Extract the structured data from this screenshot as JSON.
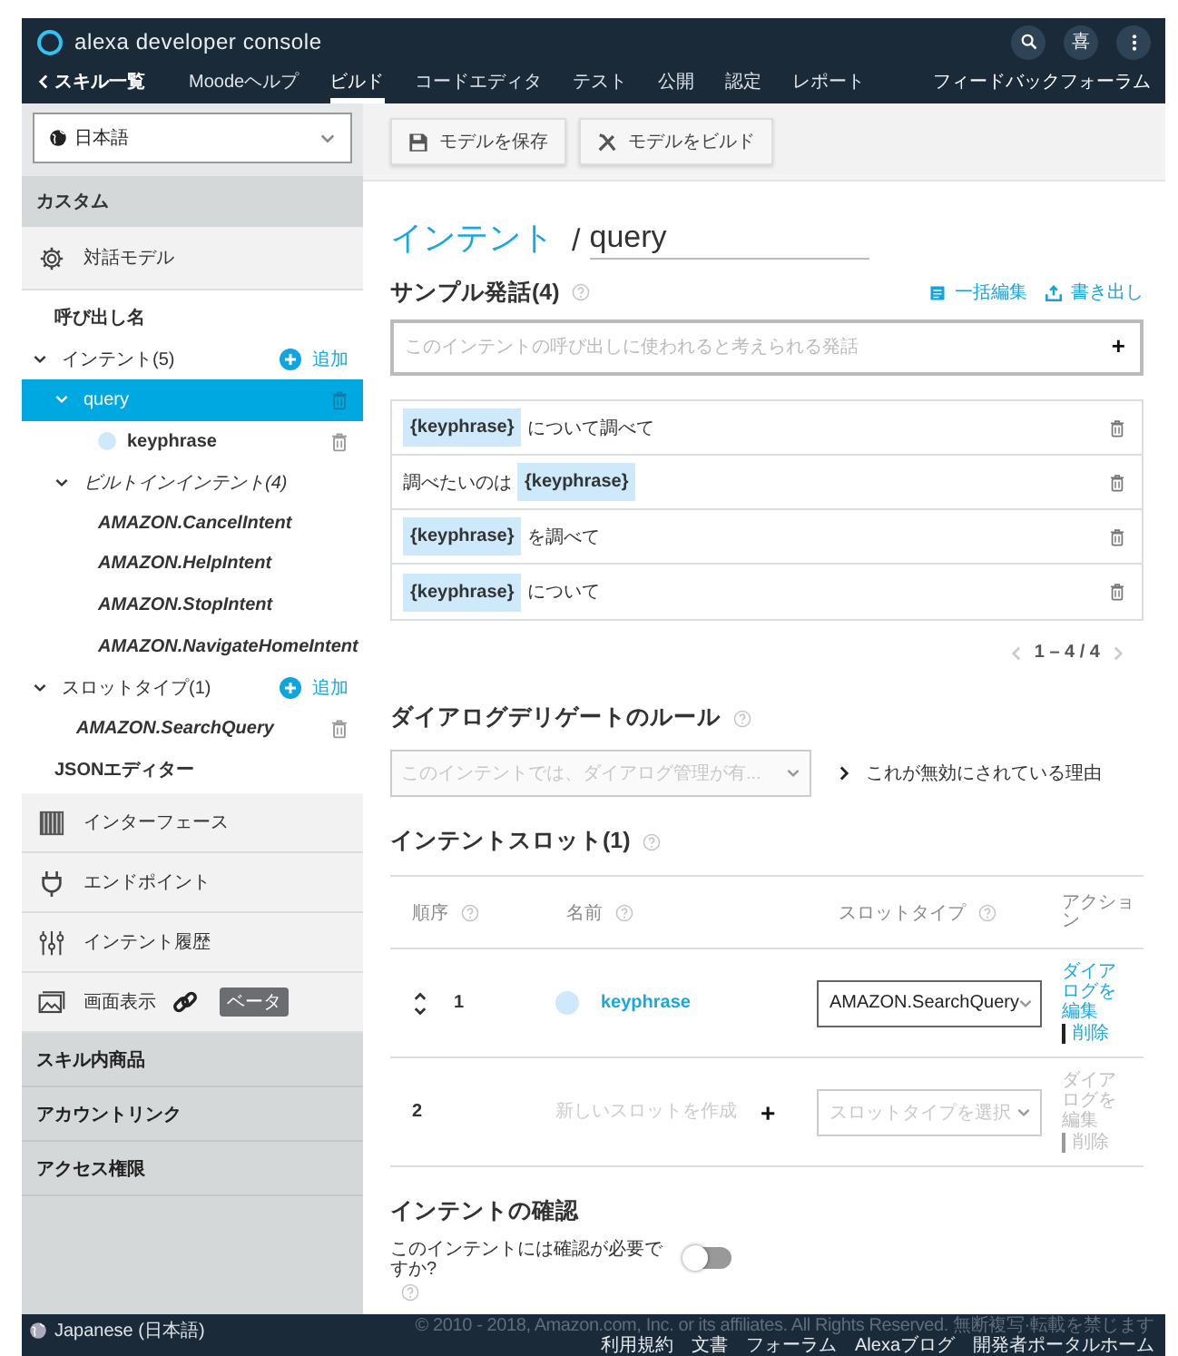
{
  "header": {
    "title": "alexa developer console",
    "avatar": "喜",
    "back": "スキル一覧",
    "nav": [
      {
        "label": "Moodeヘルプ",
        "selected": false
      },
      {
        "label": "ビルド",
        "selected": true
      },
      {
        "label": "コードエディタ",
        "selected": false
      },
      {
        "label": "テスト",
        "selected": false
      },
      {
        "label": "公開",
        "selected": false
      },
      {
        "label": "認定",
        "selected": false
      },
      {
        "label": "レポート",
        "selected": false
      }
    ],
    "feedback": "フィードバックフォーラム"
  },
  "sidebar": {
    "language": "日本語",
    "section_title": "カスタム",
    "model": "対話モデル",
    "tree": [
      {
        "kind": "link",
        "label": "呼び出し名",
        "selected": false
      },
      {
        "kind": "group",
        "label": "インテント(5)",
        "selected": false,
        "expanded": true,
        "action": "追加",
        "children": [
          {
            "kind": "item",
            "label": "query",
            "selected": true,
            "expanded": true,
            "deletable": true,
            "children": [
              {
                "kind": "slot",
                "label": "keyphrase",
                "selected": false,
                "deletable": true
              }
            ]
          },
          {
            "kind": "builtin_group",
            "label": "ビルトインインテント(4)",
            "selected": false,
            "expanded": true,
            "children": [
              {
                "kind": "builtin",
                "label": "AMAZON.CancelIntent",
                "selected": false
              },
              {
                "kind": "builtin",
                "label": "AMAZON.HelpIntent",
                "selected": false
              },
              {
                "kind": "builtin",
                "label": "AMAZON.StopIntent",
                "selected": false
              },
              {
                "kind": "builtin",
                "label": "AMAZON.NavigateHomeIntent",
                "selected": false
              }
            ]
          }
        ]
      },
      {
        "kind": "group",
        "label": "スロットタイプ(1)",
        "selected": false,
        "expanded": true,
        "action": "追加",
        "children": [
          {
            "kind": "builtin",
            "label": "AMAZON.SearchQuery",
            "selected": false,
            "deletable": true
          }
        ]
      },
      {
        "kind": "link",
        "label": "JSONエディター",
        "selected": false
      }
    ],
    "tools": [
      {
        "kind": "interface",
        "label": "インターフェース",
        "linked": false
      },
      {
        "kind": "endpoint",
        "label": "エンドポイント",
        "linked": false
      },
      {
        "kind": "history",
        "label": "インテント履歴",
        "linked": false
      },
      {
        "kind": "display",
        "label": "画面表示",
        "linked": true,
        "badge": "ベータ"
      }
    ],
    "sections": [
      "スキル内商品",
      "アカウントリンク",
      "アクセス権限"
    ]
  },
  "toolbar": [
    {
      "kind": "save",
      "label": "モデルを保存"
    },
    {
      "kind": "build",
      "label": "モデルをビルド"
    }
  ],
  "breadcrumb": {
    "link": "インテント",
    "separator": "/",
    "name": "query"
  },
  "utterances": {
    "title": "サンプル発話(4)",
    "help": true,
    "actions": [
      {
        "kind": "edit",
        "label": "一括編集"
      },
      {
        "kind": "export",
        "label": "書き出し"
      }
    ],
    "placeholder": "このインテントの呼び出しに使われると考えられる発話",
    "add": "+",
    "items": [
      {
        "parts": [
          {
            "kind": "slot",
            "text": "{keyphrase}"
          },
          {
            "kind": "text",
            "text": "について調べて"
          }
        ]
      },
      {
        "parts": [
          {
            "kind": "text",
            "text": "調べたいのは"
          },
          {
            "kind": "slot",
            "text": "{keyphrase}"
          }
        ]
      },
      {
        "parts": [
          {
            "kind": "slot",
            "text": "{keyphrase}"
          },
          {
            "kind": "text",
            "text": "を調べて"
          }
        ]
      },
      {
        "parts": [
          {
            "kind": "slot",
            "text": "{keyphrase}"
          },
          {
            "kind": "text",
            "text": "について"
          }
        ]
      }
    ],
    "pagination": "1 – 4 / 4"
  },
  "dialog": {
    "title": "ダイアログデリゲートのルール",
    "help": true,
    "select": "このインテントでは、ダイアログ管理が有...",
    "disabled": true,
    "reason": "これが無効にされている理由"
  },
  "slots": {
    "title": "インテントスロット(1)",
    "help": true,
    "columns": [
      {
        "label": "順序",
        "help": true
      },
      {
        "label": "名前",
        "help": true
      },
      {
        "label": "スロットタイプ",
        "help": true
      },
      {
        "label": "アクション",
        "help": false
      }
    ],
    "rows": [
      {
        "kind": "slot",
        "order": "1",
        "name": "keyphrase",
        "type": "AMAZON.SearchQuery",
        "actions": [
          "ダイアログを編集",
          "削除"
        ],
        "disabled": false
      },
      {
        "kind": "new",
        "order": "2",
        "name_placeholder": "新しいスロットを作成",
        "add": "+",
        "type_placeholder": "スロットタイプを選択",
        "actions": [
          "ダイアログを編集",
          "削除"
        ],
        "disabled": true
      }
    ]
  },
  "confirmation": {
    "title": "インテントの確認",
    "question": "このインテントには確認が必要ですか?",
    "help": true,
    "on": false
  },
  "footer": {
    "language": "Japanese (日本語)",
    "copyright": "© 2010 - 2018, Amazon.com, Inc. or its affiliates. All Rights Reserved. 無断複写·転載を禁じます",
    "links": [
      "利用規約",
      "文書",
      "フォーラム",
      "Alexaブログ",
      "開発者ポータルホーム"
    ]
  }
}
